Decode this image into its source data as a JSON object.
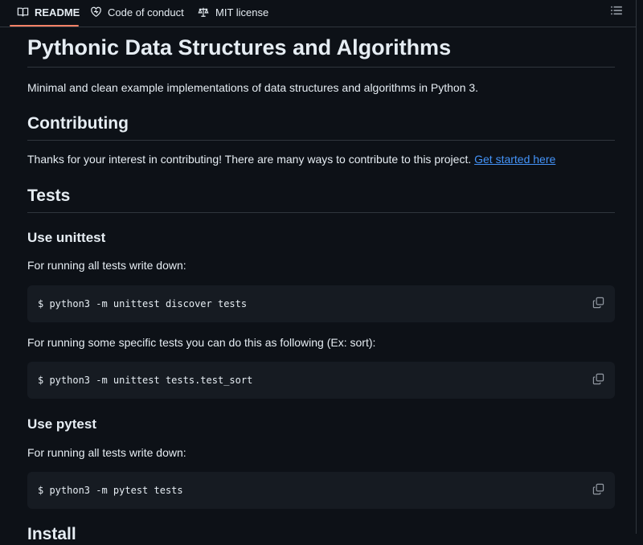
{
  "tabs": [
    {
      "label": "README",
      "icon": "book-icon",
      "active": true
    },
    {
      "label": "Code of conduct",
      "icon": "heart-icon",
      "active": false
    },
    {
      "label": "MIT license",
      "icon": "law-scale-icon",
      "active": false
    }
  ],
  "outline_icon": "list-icon",
  "readme": {
    "title": "Pythonic Data Structures and Algorithms",
    "intro": "Minimal and clean example implementations of data structures and algorithms in Python 3.",
    "contributing": {
      "heading": "Contributing",
      "text": "Thanks for your interest in contributing! There are many ways to contribute to this project.",
      "link": "Get started here"
    },
    "tests": {
      "heading": "Tests",
      "unittest": {
        "heading": "Use unittest",
        "all_text": "For running all tests write down:",
        "all_cmd": "$ python3 -m unittest discover tests",
        "specific_text": "For running some specific tests you can do this as following (Ex: sort):",
        "specific_cmd": "$ python3 -m unittest tests.test_sort"
      },
      "pytest": {
        "heading": "Use pytest",
        "all_text": "For running all tests write down:",
        "all_cmd": "$ python3 -m pytest tests"
      }
    },
    "next_heading": "Install"
  },
  "colors": {
    "background": "#0d1117",
    "code_background": "#161b22",
    "border": "#30363d",
    "text": "#e6edf3",
    "link": "#4493f8",
    "active_tab_underline": "#f78166"
  }
}
